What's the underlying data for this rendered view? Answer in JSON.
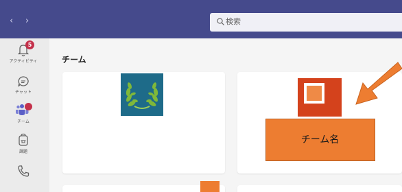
{
  "topbar": {
    "back_glyph": "‹",
    "forward_glyph": "›",
    "search_placeholder": "検索",
    "background_color": "#454a8c"
  },
  "rail": {
    "items": [
      {
        "label": "アクティビティ",
        "icon": "bell-icon",
        "badge": "5"
      },
      {
        "label": "チャット",
        "icon": "chat-icon"
      },
      {
        "label": "チーム",
        "icon": "teams-icon",
        "badge": "dot",
        "active": true
      },
      {
        "label": "課題",
        "icon": "backpack-icon"
      },
      {
        "label": "",
        "icon": "phone-icon"
      }
    ]
  },
  "main": {
    "title": "チーム"
  },
  "annotation": {
    "callout_text": "チーム名",
    "callout_color": "#ed7d31",
    "team_square_color": "#d4421c",
    "team_avatar_color": "#1e6b89"
  }
}
